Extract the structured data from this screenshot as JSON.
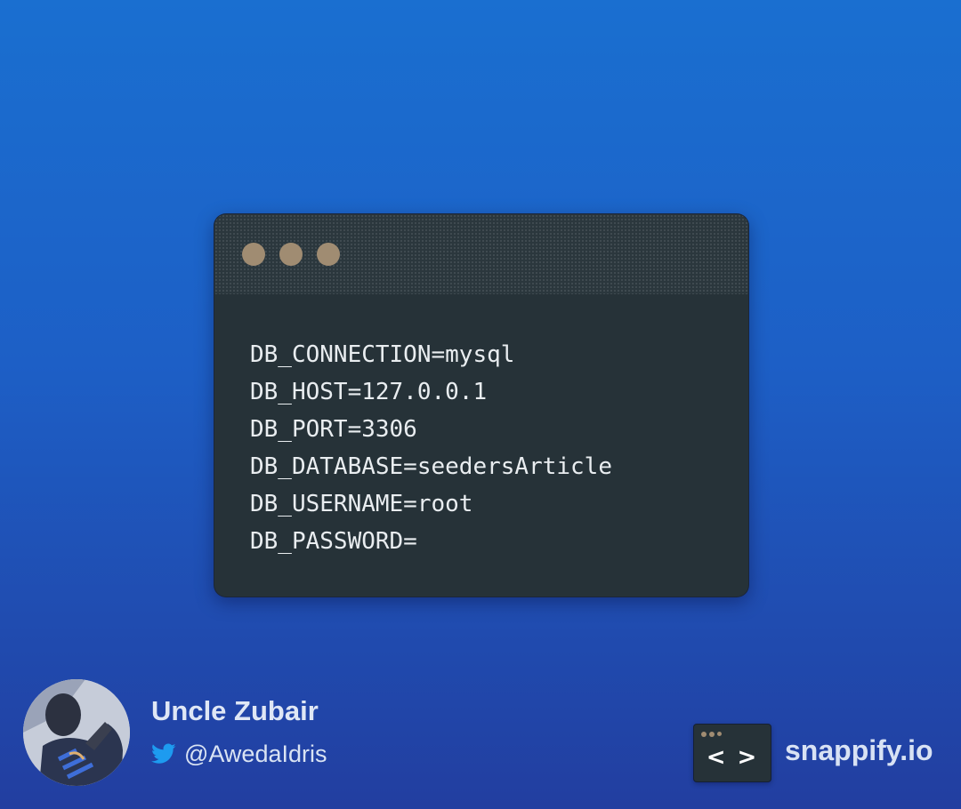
{
  "code_window": {
    "lines": [
      "DB_CONNECTION=mysql",
      "DB_HOST=127.0.0.1",
      "DB_PORT=3306",
      "DB_DATABASE=seedersArticle",
      "DB_USERNAME=root",
      "DB_PASSWORD="
    ],
    "window_dot_color": "#a08c72",
    "background_color": "#263238"
  },
  "author": {
    "name": "Uncle Zubair",
    "handle": "@AwedaIdris",
    "icon": "twitter-icon"
  },
  "brand": {
    "name": "snappify.io",
    "logo_glyph": "< >"
  },
  "colors": {
    "background_top": "#1a6fd0",
    "background_bottom": "#223ea0",
    "twitter_blue": "#1d9bf0"
  }
}
